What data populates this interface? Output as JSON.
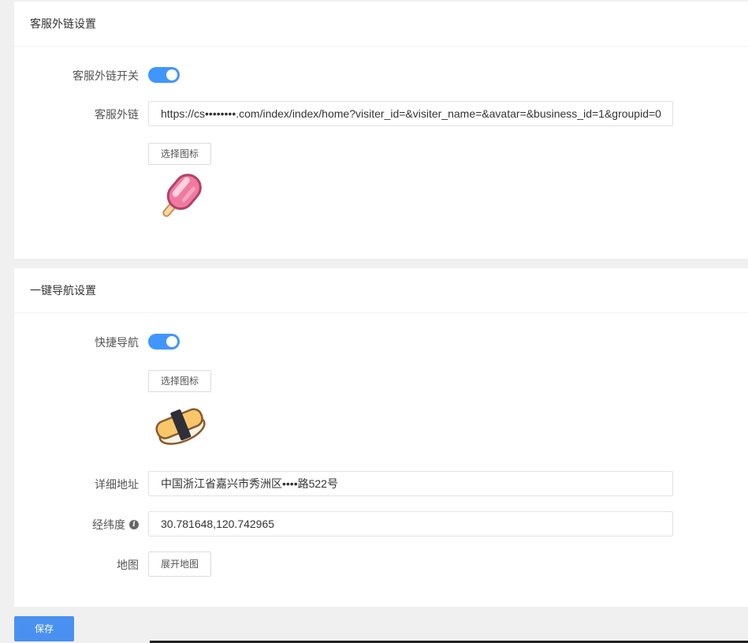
{
  "section1": {
    "title": "客服外链设置",
    "switch_label": "客服外链开关",
    "switch_on": true,
    "link_label": "客服外链",
    "link_value": "https://cs••••••••.com/index/index/home?visiter_id=&visiter_name=&avatar=&business_id=1&groupid=0",
    "choose_icon_label": "选择图标",
    "icon": "popsicle-icon"
  },
  "section2": {
    "title": "一键导航设置",
    "switch_label": "快捷导航",
    "switch_on": true,
    "choose_icon_label": "选择图标",
    "icon": "sushi-icon",
    "address_label": "详细地址",
    "address_value": "中国浙江省嘉兴市秀洲区••••路522号",
    "latlng_label": "经纬度",
    "latlng_value": "30.781648,120.742965",
    "map_label": "地图",
    "map_button": "展开地图"
  },
  "footer": {
    "save_label": "保存"
  },
  "colors": {
    "accent": "#4096ff",
    "save": "#4a90f0"
  }
}
